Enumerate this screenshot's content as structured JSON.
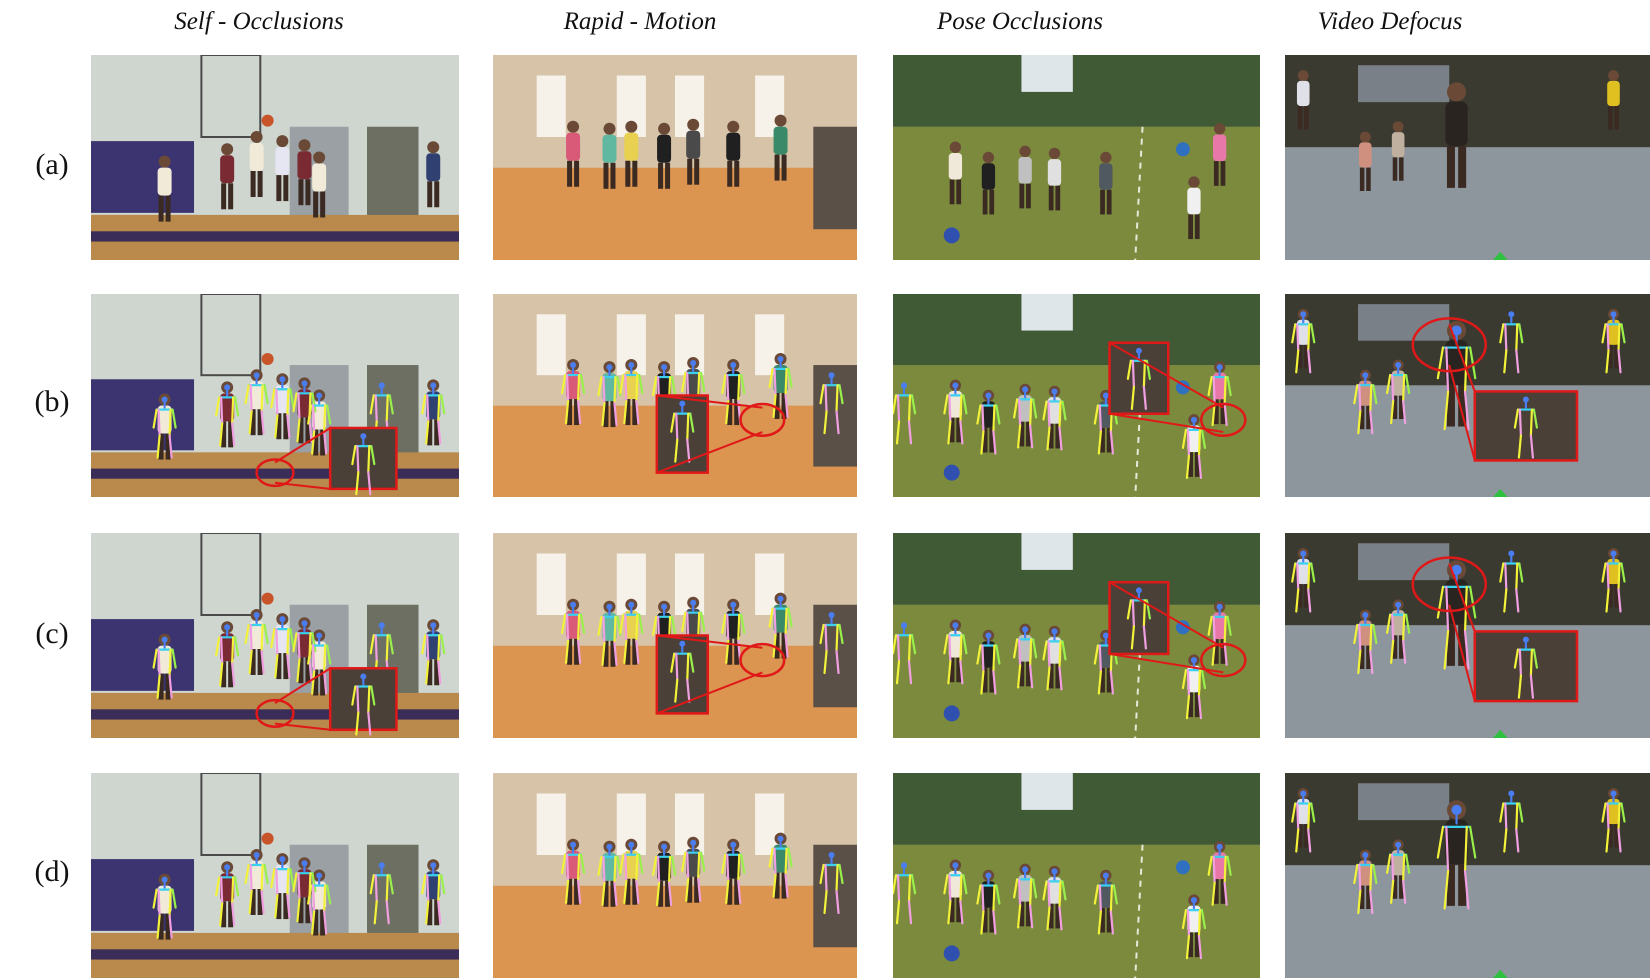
{
  "columns": [
    {
      "title": "Self - Occlusions",
      "scene": "basketball"
    },
    {
      "title": "Rapid - Motion",
      "scene": "dance"
    },
    {
      "title": "Pose Occlusions",
      "scene": "field"
    },
    {
      "title": "Video Defocus",
      "scene": "skate"
    }
  ],
  "rows": [
    {
      "label": "(a)",
      "mode": "plain"
    },
    {
      "label": "(b)",
      "mode": "poses-zoom"
    },
    {
      "label": "(c)",
      "mode": "poses-zoom"
    },
    {
      "label": "(d)",
      "mode": "poses"
    }
  ],
  "colors": {
    "pose_yellow": "#f2f23a",
    "pose_pink": "#f0a0e0",
    "pose_blue": "#4a7df0",
    "pose_cyan": "#3ad0f0",
    "pose_green": "#9af04a",
    "zoom_box": "#e01818"
  }
}
